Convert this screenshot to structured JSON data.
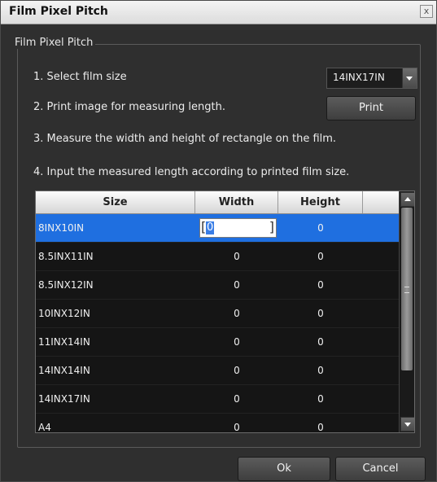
{
  "window": {
    "title": "Film Pixel Pitch",
    "close_label": "x"
  },
  "group": {
    "legend": "Film Pixel Pitch"
  },
  "steps": [
    "1. Select film size",
    "2. Print image for measuring length.",
    "3. Measure the width and height of rectangle on the film.",
    "4. Input the measured length according to printed film size."
  ],
  "film_size_select": {
    "value": "14INX17IN"
  },
  "buttons": {
    "print": "Print",
    "ok": "Ok",
    "cancel": "Cancel"
  },
  "table": {
    "headers": [
      "Size",
      "Width",
      "Height"
    ],
    "rows": [
      {
        "size": "8INX10IN",
        "width": "0",
        "height": "0"
      },
      {
        "size": "8.5INX11IN",
        "width": "0",
        "height": "0"
      },
      {
        "size": "8.5INX12IN",
        "width": "0",
        "height": "0"
      },
      {
        "size": "10INX12IN",
        "width": "0",
        "height": "0"
      },
      {
        "size": "11INX14IN",
        "width": "0",
        "height": "0"
      },
      {
        "size": "14INX14IN",
        "width": "0",
        "height": "0"
      },
      {
        "size": "14INX17IN",
        "width": "0",
        "height": "0"
      },
      {
        "size": "A4",
        "width": "0",
        "height": "0"
      }
    ]
  },
  "colors": {
    "selection": "#1f6fe0",
    "background": "#2f2f2f"
  }
}
